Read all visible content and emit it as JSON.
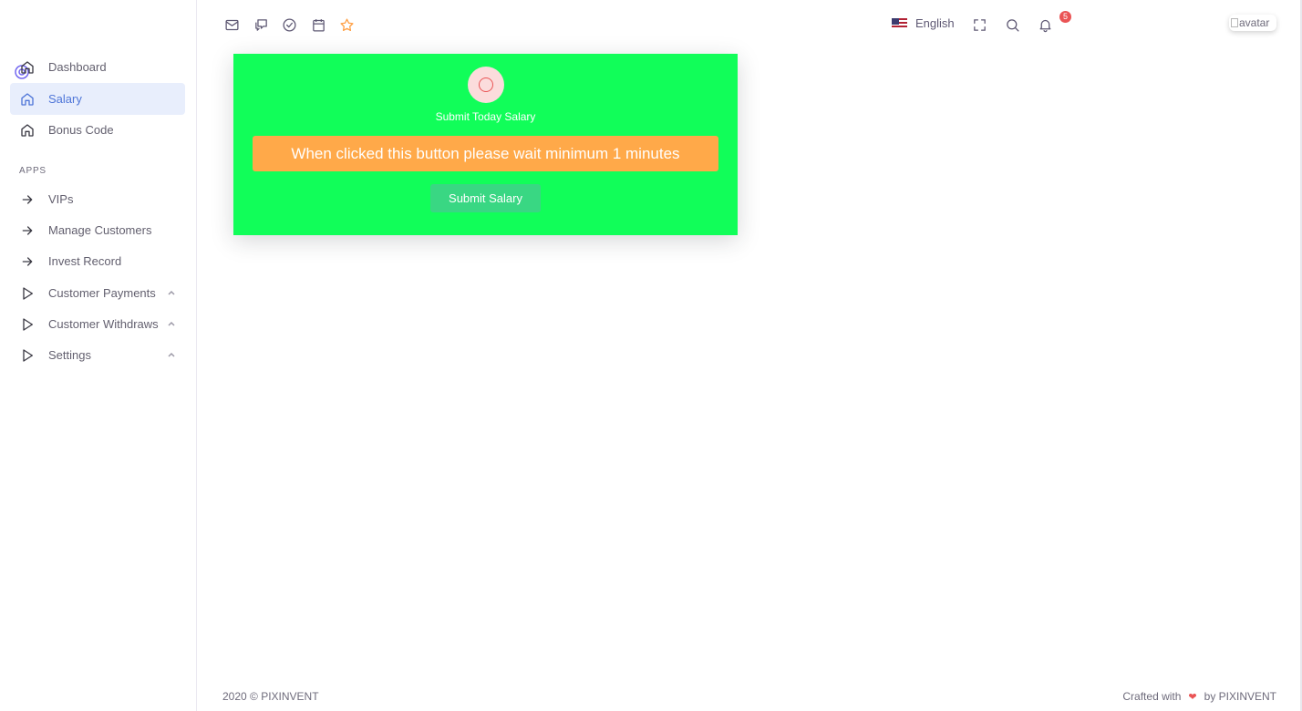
{
  "sidebar": {
    "items": [
      {
        "label": "Dashboard",
        "icon": "home-icon"
      },
      {
        "label": "Salary",
        "icon": "home-icon",
        "active": true
      },
      {
        "label": "Bonus Code",
        "icon": "home-icon"
      }
    ],
    "section_header": "APPS",
    "apps": [
      {
        "label": "VIPs",
        "icon": "arrow-right-icon"
      },
      {
        "label": "Manage Customers",
        "icon": "arrow-right-icon"
      },
      {
        "label": "Invest Record",
        "icon": "arrow-right-icon"
      },
      {
        "label": "Customer Payments",
        "icon": "play-icon",
        "expandable": true
      },
      {
        "label": "Customer Withdraws",
        "icon": "play-icon",
        "expandable": true
      },
      {
        "label": "Settings",
        "icon": "play-icon",
        "expandable": true
      }
    ]
  },
  "topbar": {
    "shortcuts": [
      "mail-icon",
      "chat-icon",
      "check-circle-icon",
      "calendar-icon",
      "star-icon"
    ],
    "language": "English",
    "notification_count": "5",
    "avatar_alt": "avatar"
  },
  "card": {
    "title": "Submit Today Salary",
    "notice": "When clicked this button please wait minimum 1 minutes",
    "button_label": "Submit Salary"
  },
  "footer": {
    "copyright": "2020 © PIXINVENT",
    "crafted_prefix": "Crafted with",
    "crafted_suffix": "by PIXINVENT"
  },
  "colors": {
    "card_bg": "#11fe59",
    "notice_bg": "#ffa949",
    "button_bg": "#39d783",
    "active_item_bg": "#e8eefc",
    "active_item_text": "#4f76d8",
    "star": "#ff9f43",
    "badge": "#ea5455"
  }
}
